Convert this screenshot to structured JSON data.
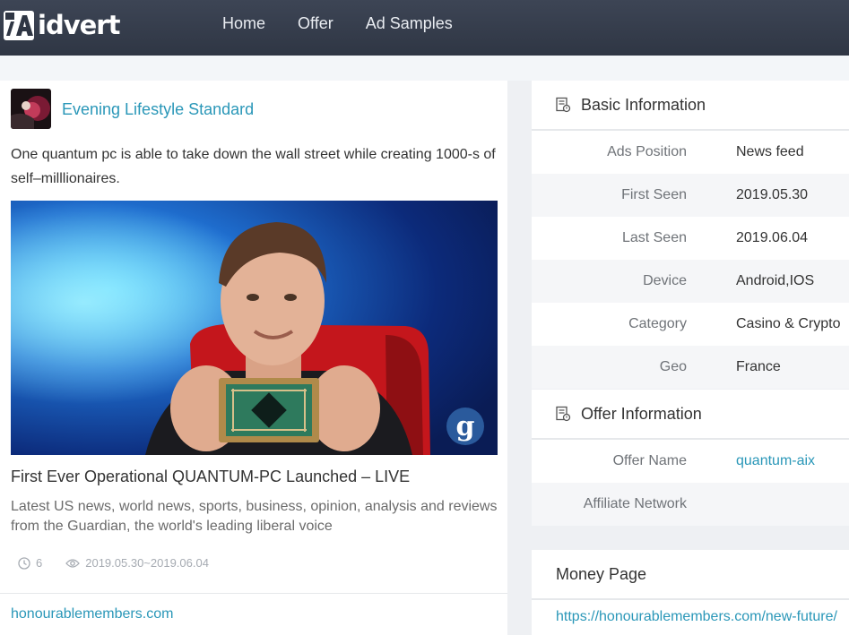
{
  "nav": {
    "logo_text": "idvert",
    "links": [
      "Home",
      "Offer",
      "Ad Samples"
    ]
  },
  "ad": {
    "advertiser": "Evening Lifestyle Standard",
    "body": "One quantum pc is able to take down the wall street while creating 1000-s of self–milllionaires.",
    "image_logo": "g",
    "title": "First Ever Operational QUANTUM-PC Launched – LIVE",
    "description": "Latest US news, world news, sports, business, opinion, analysis and reviews from the Guardian, the world's leading liberal voice",
    "count": "6",
    "date_range": "2019.05.30~2019.06.04",
    "domain": "honourablemembers.com"
  },
  "basic_info": {
    "title": "Basic Information",
    "rows": [
      {
        "label": "Ads Position",
        "value": "News feed"
      },
      {
        "label": "First Seen",
        "value": "2019.05.30"
      },
      {
        "label": "Last Seen",
        "value": "2019.06.04"
      },
      {
        "label": "Device",
        "value": "Android,IOS"
      },
      {
        "label": "Category",
        "value": "Casino & Crypto"
      },
      {
        "label": "Geo",
        "value": "France"
      }
    ]
  },
  "offer_info": {
    "title": "Offer Information",
    "rows": [
      {
        "label": "Offer Name",
        "value": "quantum-aix"
      },
      {
        "label": "Affiliate Network",
        "value": ""
      }
    ]
  },
  "money_page": {
    "title": "Money Page",
    "url": "https://honourablemembers.com/new-future/"
  },
  "colors": {
    "nav_bg": "#353c4b",
    "accent_link": "#2a97b8",
    "page_bg": "#eef0f3"
  }
}
